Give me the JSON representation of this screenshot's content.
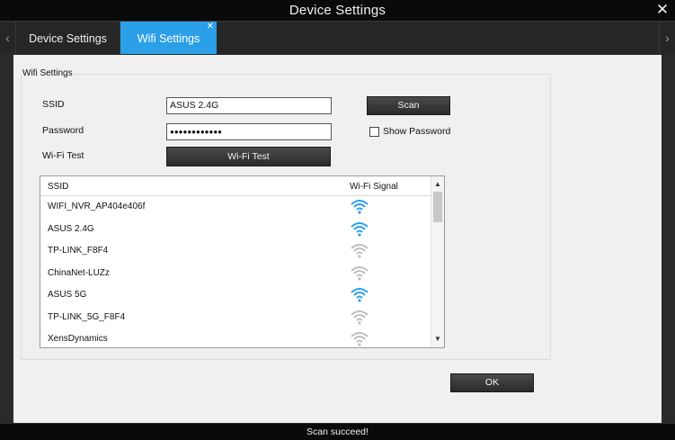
{
  "window": {
    "title": "Device Settings"
  },
  "tabs": [
    {
      "label": "Device Settings"
    },
    {
      "label": "Wifi Settings",
      "active": true
    }
  ],
  "group": {
    "title": "Wifi Settings"
  },
  "form": {
    "ssid_label": "SSID",
    "ssid_value": "ASUS 2.4G",
    "password_label": "Password",
    "password_value": "●●●●●●●●●●●●",
    "wifi_test_label": "Wi-Fi Test",
    "wifi_test_button": "Wi-Fi Test",
    "scan_button": "Scan",
    "show_password_label": "Show Password",
    "show_password_checked": false
  },
  "network_list": {
    "columns": [
      "SSID",
      "Wi-Fi Signal"
    ],
    "rows": [
      {
        "ssid": "WIFI_NVR_AP404e406f",
        "signal_icon": "wifi-signal-icon",
        "color": "#2b9fe8"
      },
      {
        "ssid": "ASUS 2.4G",
        "signal_icon": "wifi-signal-icon",
        "color": "#2b9fe8"
      },
      {
        "ssid": "TP-LINK_F8F4",
        "signal_icon": "wifi-signal-icon",
        "color": "#bdbdbd"
      },
      {
        "ssid": "ChinaNet-LUZz",
        "signal_icon": "wifi-signal-icon",
        "color": "#bdbdbd"
      },
      {
        "ssid": "ASUS 5G",
        "signal_icon": "wifi-signal-icon",
        "color": "#2b9fe8"
      },
      {
        "ssid": "TP-LINK_5G_F8F4",
        "signal_icon": "wifi-signal-icon",
        "color": "#bdbdbd"
      },
      {
        "ssid": "XensDynamics",
        "signal_icon": "wifi-signal-icon",
        "color": "#bdbdbd"
      }
    ]
  },
  "ok_button": "OK",
  "status": "Scan succeed!",
  "colors": {
    "accent": "#2b9fe8",
    "titlebar": "#0a0a0a",
    "panel": "#f0f0f0"
  }
}
